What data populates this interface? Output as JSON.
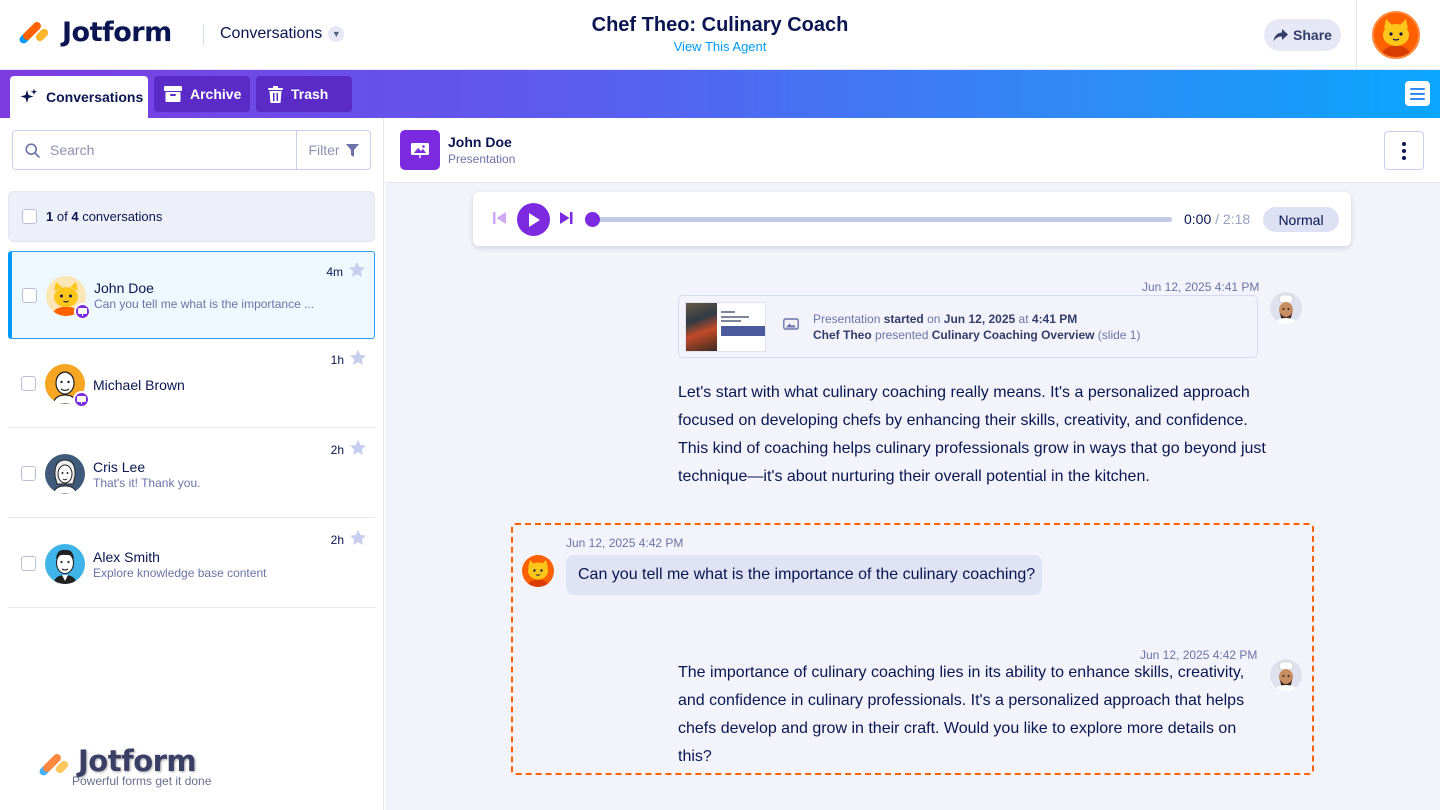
{
  "app": {
    "brand": "Jotform",
    "section_dropdown": "Conversations",
    "agent_title": "Chef Theo: Culinary Coach",
    "agent_link": "View This Agent",
    "share_label": "Share"
  },
  "tabs": [
    {
      "label": "Conversations",
      "icon": "sparkle-icon",
      "active": true
    },
    {
      "label": "Archive",
      "icon": "archive-icon",
      "active": false
    },
    {
      "label": "Trash",
      "icon": "trash-icon",
      "active": false
    }
  ],
  "sidebar": {
    "search_placeholder": "Search",
    "filter_label": "Filter",
    "count_selected": "1",
    "count_of": "of",
    "count_total": "4",
    "count_suffix": "conversations",
    "items": [
      {
        "name": "John Doe",
        "preview": "Can you tell me what is the importance ...",
        "time": "4m",
        "active": true,
        "badge": "presentation-icon"
      },
      {
        "name": "Michael Brown",
        "preview": "",
        "time": "1h",
        "active": false,
        "badge": "presentation-icon"
      },
      {
        "name": "Cris Lee",
        "preview": "That's it! Thank you.",
        "time": "2h",
        "active": false
      },
      {
        "name": "Alex Smith",
        "preview": "Explore knowledge base content",
        "time": "2h",
        "active": false
      }
    ],
    "watermark_brand": "Jotform",
    "watermark_tagline": "Powerful forms get it done"
  },
  "conversation": {
    "user_name": "John Doe",
    "channel": "Presentation",
    "player": {
      "current": "0:00",
      "separator": "/",
      "duration": "2:18",
      "speed": "Normal",
      "progress": 0
    },
    "messages": [
      {
        "kind": "presentation-event",
        "timestamp": "Jun 12, 2025 4:41 PM",
        "line1_prefix": "Presentation",
        "line1_bold1": "started",
        "line1_mid": "on",
        "line1_bold2": "Jun 12, 2025",
        "line1_mid2": "at",
        "line1_bold3": "4:41 PM",
        "line2_bold1": "Chef Theo",
        "line2_mid": "presented",
        "line2_bold2": "Culinary Coaching Overview",
        "line2_suffix": "(slide 1)"
      },
      {
        "kind": "agent",
        "text": "Let's start with what culinary coaching really means. It's a personalized approach focused on developing chefs by enhancing their skills, creativity, and confidence. This kind of coaching helps culinary professionals grow in ways that go beyond just technique—it's about nurturing their overall potential in the kitchen."
      },
      {
        "kind": "user",
        "timestamp": "Jun 12, 2025 4:42 PM",
        "text": "Can you tell me what is the importance of the culinary coaching?"
      },
      {
        "kind": "agent",
        "timestamp": "Jun 12, 2025 4:42 PM",
        "text": "The importance of culinary coaching lies in its ability to enhance skills, creativity, and confidence in culinary professionals. It's a personalized approach that helps chefs develop and grow in their craft. Would you like to explore more details on this?"
      }
    ]
  },
  "colors": {
    "brand_navy": "#0a1551",
    "accent_purple": "#7b2ae0",
    "link_blue": "#0099ff",
    "highlight_orange": "#ff6100"
  }
}
